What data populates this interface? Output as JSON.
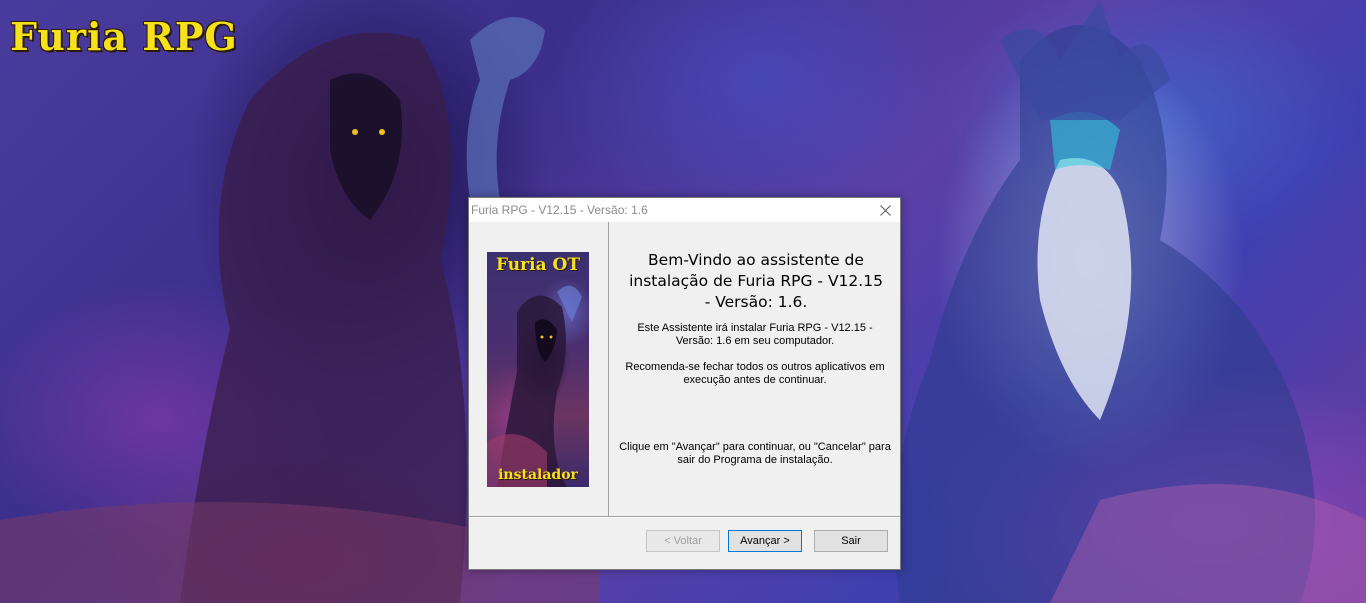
{
  "background": {
    "logo_text": "Furia RPG"
  },
  "dialog": {
    "title": "Furia RPG - V12.15 - Versão: 1.6",
    "close_icon": "close-icon",
    "banner": {
      "top_text": "Furia OT",
      "bottom_text": "instalador"
    },
    "heading": "Bem-Vindo ao assistente de instalação de Furia RPG - V12.15 - Versão: 1.6.",
    "paragraph1": "Este Assistente irá instalar Furia RPG - V12.15 - Versão: 1.6 em seu computador.",
    "paragraph2": "Recomenda-se fechar todos os outros aplicativos em execução antes de continuar.",
    "paragraph3": "Clique em \"Avançar\" para continuar, ou \"Cancelar\" para sair do Programa de instalação.",
    "buttons": {
      "back": "< Voltar",
      "next": "Avançar >",
      "exit": "Sair"
    }
  },
  "colors": {
    "logo": "#f6e21a",
    "dialog_bg": "#f0f0f0",
    "accent_border": "#0078d7"
  }
}
